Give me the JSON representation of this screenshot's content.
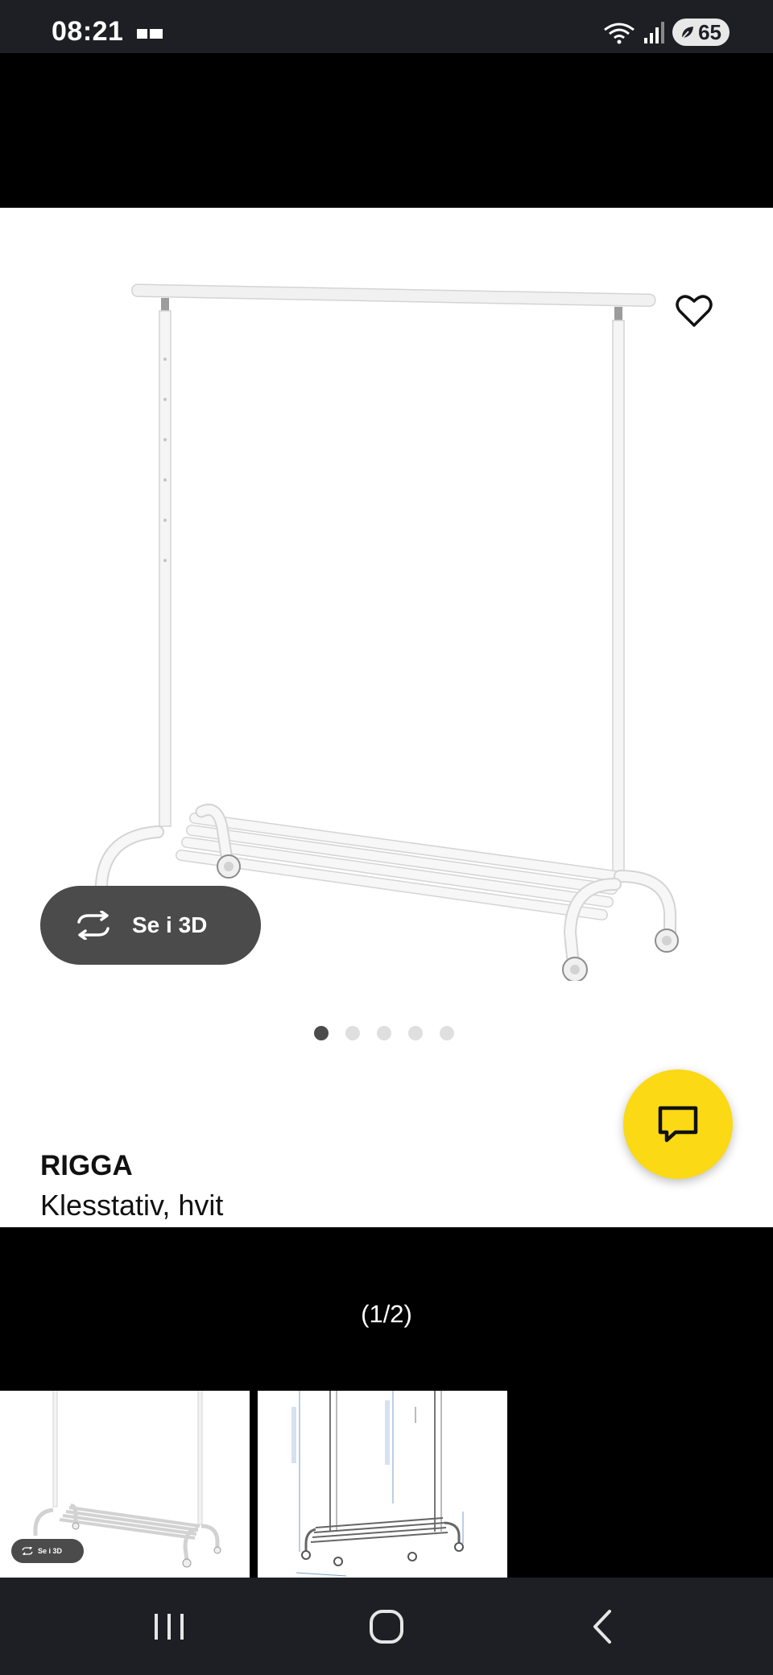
{
  "status_bar": {
    "time": "08:21",
    "battery": "65",
    "icons": [
      "notification-icon",
      "wifi-icon",
      "signal-icon",
      "battery-saver-icon"
    ]
  },
  "gallery": {
    "see_3d_label": "Se i 3D",
    "dots_total": 5,
    "dots_active": 1
  },
  "product": {
    "name": "RIGGA",
    "description": "Klesstativ, hvit"
  },
  "viewer": {
    "counter": "(1/2)",
    "thumb_3d_label": "Se i 3D"
  },
  "colors": {
    "accent_yellow": "#fbd914",
    "pill_gray": "#4b4b4b",
    "system_bar": "#1e1f24"
  }
}
